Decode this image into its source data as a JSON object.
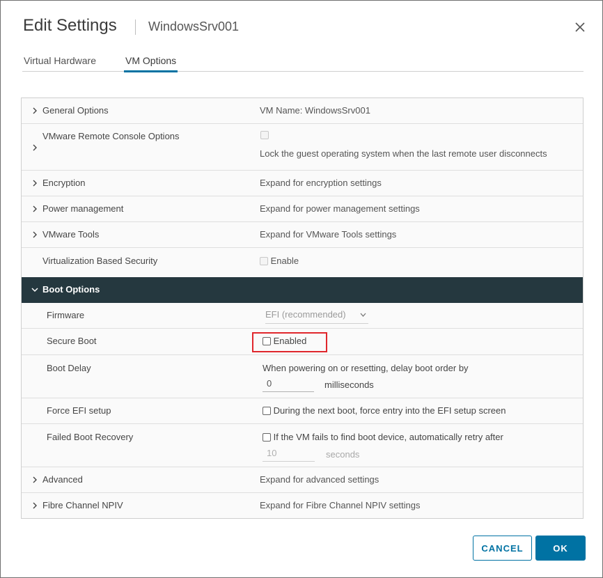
{
  "dialog": {
    "title": "Edit Settings",
    "subtitle": "WindowsSrv001",
    "close_icon": "close-icon"
  },
  "tabs": [
    {
      "label": "Virtual Hardware",
      "active": false
    },
    {
      "label": "VM Options",
      "active": true
    }
  ],
  "rows": {
    "general": {
      "label": "General Options",
      "value": "VM Name: WindowsSrv001"
    },
    "vmrc": {
      "label": "VMware Remote Console Options",
      "value": "Lock the guest operating system when the last remote user disconnects"
    },
    "encryption": {
      "label": "Encryption",
      "value": "Expand for encryption settings"
    },
    "power": {
      "label": "Power management",
      "value": "Expand for power management settings"
    },
    "tools": {
      "label": "VMware Tools",
      "value": "Expand for VMware Tools settings"
    },
    "vbs": {
      "label": "Virtualization Based Security",
      "value": "Enable"
    },
    "advanced": {
      "label": "Advanced",
      "value": "Expand for advanced settings"
    },
    "npiv": {
      "label": "Fibre Channel NPIV",
      "value": "Expand for Fibre Channel NPIV settings"
    }
  },
  "boot": {
    "header": "Boot Options",
    "firmware": {
      "label": "Firmware",
      "value": "EFI (recommended)"
    },
    "secure_boot": {
      "label": "Secure Boot",
      "value": "Enabled"
    },
    "delay": {
      "label": "Boot Delay",
      "text": "When powering on or resetting, delay boot order by",
      "input": "0",
      "unit": "milliseconds"
    },
    "force_efi": {
      "label": "Force EFI setup",
      "value": "During the next boot, force entry into the EFI setup screen"
    },
    "recovery": {
      "label": "Failed Boot Recovery",
      "value": "If the VM fails to find boot device, automatically retry after",
      "input": "10",
      "unit": "seconds"
    }
  },
  "buttons": {
    "cancel": "CANCEL",
    "ok": "OK"
  },
  "colors": {
    "accent": "#0072a3",
    "header_bg": "#25383f",
    "highlight": "#e0262c"
  }
}
